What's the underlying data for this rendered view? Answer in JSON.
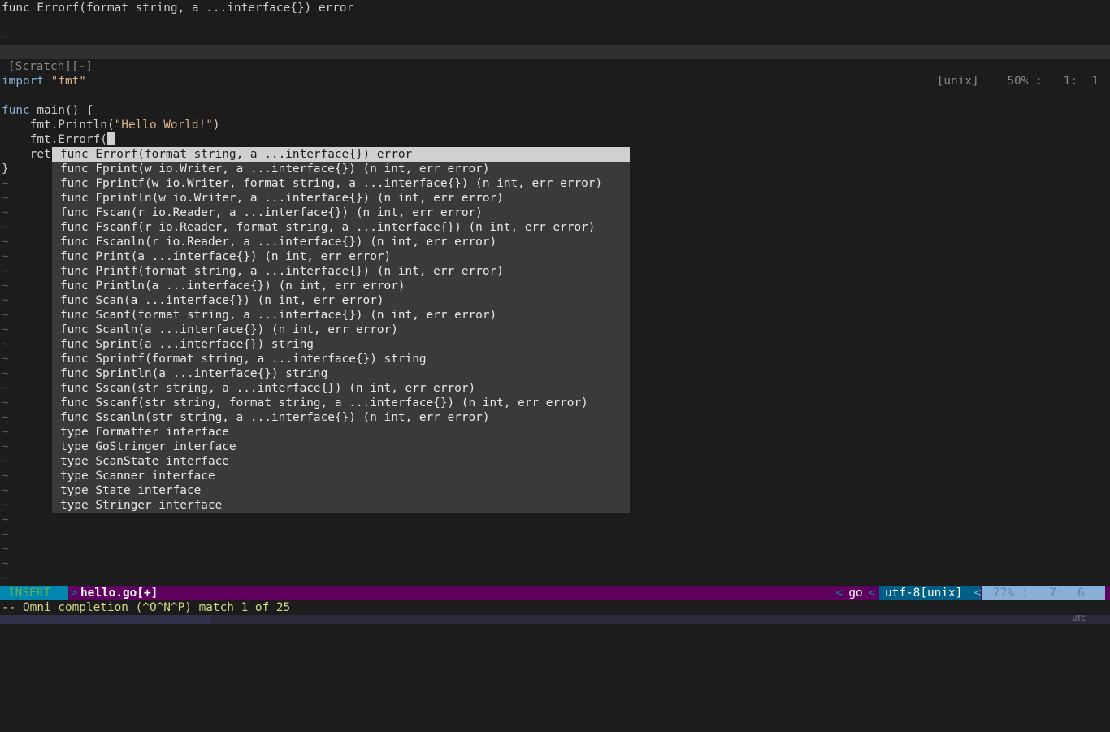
{
  "preview": {
    "signature": "func Errorf(format string, a ...interface{}) error",
    "tilde": "~"
  },
  "scratch_status": {
    "left": "[Scratch][-]",
    "right": "[unix]    50% :   1:  1"
  },
  "code": {
    "line_import_kw": "import",
    "line_import_str": "\"fmt\"",
    "line_func_kw": "func",
    "line_func_rest": " main() {",
    "line_println_pre": "    fmt.Println(",
    "line_println_str": "\"Hello World!\"",
    "line_println_post": ")",
    "line_errorf": "    fmt.Errorf(",
    "line_ret": "    ret",
    "line_close": "}",
    "tilde": "~"
  },
  "completion_items": [
    "func Errorf(format string, a ...interface{}) error",
    "func Fprint(w io.Writer, a ...interface{}) (n int, err error)",
    "func Fprintf(w io.Writer, format string, a ...interface{}) (n int, err error)",
    "func Fprintln(w io.Writer, a ...interface{}) (n int, err error)",
    "func Fscan(r io.Reader, a ...interface{}) (n int, err error)",
    "func Fscanf(r io.Reader, format string, a ...interface{}) (n int, err error)",
    "func Fscanln(r io.Reader, a ...interface{}) (n int, err error)",
    "func Print(a ...interface{}) (n int, err error)",
    "func Printf(format string, a ...interface{}) (n int, err error)",
    "func Println(a ...interface{}) (n int, err error)",
    "func Scan(a ...interface{}) (n int, err error)",
    "func Scanf(format string, a ...interface{}) (n int, err error)",
    "func Scanln(a ...interface{}) (n int, err error)",
    "func Sprint(a ...interface{}) string",
    "func Sprintf(format string, a ...interface{}) string",
    "func Sprintln(a ...interface{}) string",
    "func Sscan(str string, a ...interface{}) (n int, err error)",
    "func Sscanf(str string, format string, a ...interface{}) (n int, err error)",
    "func Sscanln(str string, a ...interface{}) (n int, err error)",
    "type Formatter interface",
    "type GoStringer interface",
    "type ScanState interface",
    "type Scanner interface",
    "type State interface",
    "type Stringer interface"
  ],
  "statusline": {
    "mode": "INSERT",
    "sep_right": ">",
    "filename": "hello.go[+]",
    "sep_left": "<",
    "filetype": "go",
    "encoding": "utf-8[unix]",
    "position": "77% :   7:  6"
  },
  "cmdline": "-- Omni completion (^O^N^P) match 1 of 25",
  "taskbar": {
    "clock": "UTC"
  },
  "colors": {
    "background": "#1c1c1c",
    "statusline": "#5f005f",
    "mode_bg": "#0087af",
    "popup_bg": "#3a3a3a",
    "popup_selected": "#d0d0d0",
    "keyword": "#87afd7",
    "string": "#d7af87"
  }
}
